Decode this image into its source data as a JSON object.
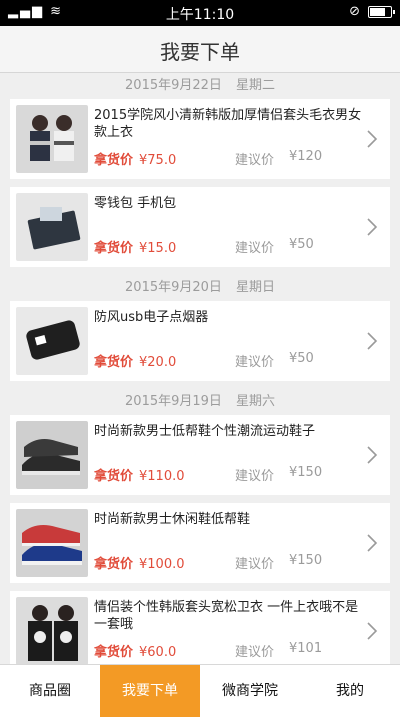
{
  "status": {
    "time": "上午11:10"
  },
  "header": {
    "title": "我要下单"
  },
  "sections": [
    {
      "date": "2015年9月22日",
      "weekday": "星期二",
      "items": [
        {
          "title": "2015学院风小清新韩版加厚情侣套头毛衣男女款上衣",
          "price_label": "拿货价",
          "price": "¥75.0",
          "suggest_label": "建议价",
          "suggest": "¥120"
        },
        {
          "title": "零钱包 手机包",
          "price_label": "拿货价",
          "price": "¥15.0",
          "suggest_label": "建议价",
          "suggest": "¥50"
        }
      ]
    },
    {
      "date": "2015年9月20日",
      "weekday": "星期日",
      "items": [
        {
          "title": "防风usb电子点烟器",
          "price_label": "拿货价",
          "price": "¥20.0",
          "suggest_label": "建议价",
          "suggest": "¥50"
        }
      ]
    },
    {
      "date": "2015年9月19日",
      "weekday": "星期六",
      "items": [
        {
          "title": "时尚新款男士低帮鞋个性潮流运动鞋子",
          "price_label": "拿货价",
          "price": "¥110.0",
          "suggest_label": "建议价",
          "suggest": "¥150"
        },
        {
          "title": "时尚新款男士休闲鞋低帮鞋",
          "price_label": "拿货价",
          "price": "¥100.0",
          "suggest_label": "建议价",
          "suggest": "¥150"
        },
        {
          "title": "情侣装个性韩版套头宽松卫衣 一件上衣哦不是一套哦",
          "price_label": "拿货价",
          "price": "¥60.0",
          "suggest_label": "建议价",
          "suggest": "¥101"
        }
      ]
    }
  ],
  "tabs": [
    {
      "label": "商品圈"
    },
    {
      "label": "我要下单"
    },
    {
      "label": "微商学院"
    },
    {
      "label": "我的"
    }
  ],
  "colors": {
    "accent": "#f39a25",
    "price": "#e14c3a",
    "muted": "#9b9b9b"
  }
}
